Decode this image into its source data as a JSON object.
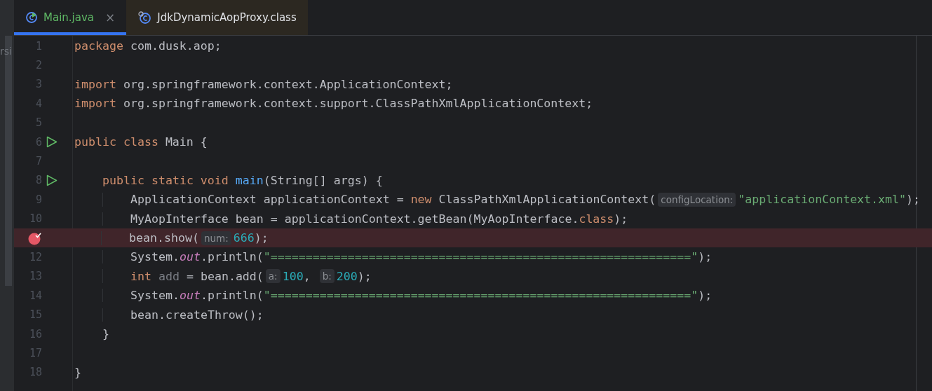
{
  "tabs": [
    {
      "label": "Main.java",
      "selected": true,
      "close": "×",
      "kind": "runnable",
      "color": "#5fb865"
    },
    {
      "label": "JdkDynamicAopProxy.class",
      "selected": false,
      "kind": "library",
      "color": "#dfe1e5"
    }
  ],
  "side_panel": {
    "label": "rsi"
  },
  "lines": [
    {
      "number": "1",
      "kind": "plain",
      "highlighted": false,
      "tokens": [
        {
          "kind": "keyword",
          "text": "package"
        },
        {
          "kind": "plain",
          "text": " com.dusk.aop;"
        }
      ]
    },
    {
      "number": "2",
      "kind": "plain",
      "highlighted": false
    },
    {
      "number": "3",
      "kind": "plain",
      "highlighted": false,
      "tokens": [
        {
          "kind": "keyword",
          "text": "import"
        },
        {
          "kind": "plain",
          "text": " org.springframework.context.ApplicationContext;"
        }
      ]
    },
    {
      "number": "4",
      "kind": "plain",
      "highlighted": false,
      "tokens": [
        {
          "kind": "keyword",
          "text": "import"
        },
        {
          "kind": "plain",
          "text": " org.springframework.context.support.ClassPathXmlApplicationContext;"
        }
      ]
    },
    {
      "number": "5",
      "kind": "plain",
      "highlighted": false
    },
    {
      "number": "6",
      "kind": "run",
      "highlighted": false,
      "tokens": [
        {
          "kind": "keyword",
          "text": "public class"
        },
        {
          "kind": "plain",
          "text": " Main {"
        }
      ],
      "children": [
        {
          "number": "7",
          "kind": "plain",
          "highlighted": false
        },
        {
          "number": "8",
          "kind": "run",
          "highlighted": false,
          "tokens": [
            {
              "kind": "keyword",
              "text": "public static void "
            },
            {
              "kind": "method",
              "text": "main"
            },
            {
              "kind": "plain",
              "text": "(String[] args) {"
            }
          ],
          "children": [
            {
              "number": "9",
              "kind": "plain",
              "highlighted": false,
              "tokens": [
                {
                  "kind": "plain",
                  "text": "ApplicationContext applicationContext = "
                },
                {
                  "kind": "keyword",
                  "text": "new"
                },
                {
                  "kind": "plain",
                  "text": " ClassPathXmlApplicationContext("
                },
                {
                  "kind": "hint",
                  "text": "configLocation:"
                },
                {
                  "kind": "string",
                  "text": "\"applicationContext.xml\""
                },
                {
                  "kind": "plain",
                  "text": ");"
                }
              ]
            },
            {
              "number": "10",
              "kind": "plain",
              "highlighted": false,
              "tokens": [
                {
                  "kind": "plain",
                  "text": "MyAopInterface bean = applicationContext.getBean(MyAopInterface."
                },
                {
                  "kind": "keyword",
                  "text": "class"
                },
                {
                  "kind": "plain",
                  "text": ");"
                }
              ]
            },
            {
              "kind": "breakpoint",
              "highlighted": true,
              "tokens": [
                {
                  "kind": "plain",
                  "text": "bean.show("
                },
                {
                  "kind": "hint",
                  "text": "num:"
                },
                {
                  "kind": "number",
                  "text": "666"
                },
                {
                  "kind": "plain",
                  "text": ");"
                }
              ]
            },
            {
              "number": "12",
              "kind": "plain",
              "highlighted": false,
              "tokens": [
                {
                  "kind": "plain",
                  "text": "System."
                },
                {
                  "kind": "field",
                  "text": "out"
                },
                {
                  "kind": "plain",
                  "text": ".println("
                },
                {
                  "kind": "string",
                  "text": "\"============================================================\""
                },
                {
                  "kind": "plain",
                  "text": ");"
                }
              ]
            },
            {
              "number": "13",
              "kind": "plain",
              "highlighted": false,
              "tokens": [
                {
                  "kind": "keyword",
                  "text": "int "
                },
                {
                  "kind": "unused",
                  "text": "add"
                },
                {
                  "kind": "plain",
                  "text": " = bean.add("
                },
                {
                  "kind": "hint",
                  "text": "a:"
                },
                {
                  "kind": "number",
                  "text": "100"
                },
                {
                  "kind": "plain",
                  "text": ", "
                },
                {
                  "kind": "hint",
                  "text": "b:"
                },
                {
                  "kind": "number",
                  "text": "200"
                },
                {
                  "kind": "plain",
                  "text": ");"
                }
              ]
            },
            {
              "number": "14",
              "kind": "plain",
              "highlighted": false,
              "tokens": [
                {
                  "kind": "plain",
                  "text": "System."
                },
                {
                  "kind": "field",
                  "text": "out"
                },
                {
                  "kind": "plain",
                  "text": ".println("
                },
                {
                  "kind": "string",
                  "text": "\"============================================================\""
                },
                {
                  "kind": "plain",
                  "text": ");"
                }
              ]
            },
            {
              "number": "15",
              "kind": "plain",
              "highlighted": false,
              "tokens": [
                {
                  "kind": "plain",
                  "text": "bean.createThrow();"
                }
              ]
            }
          ]
        },
        {
          "number": "16",
          "kind": "plain",
          "highlighted": false,
          "tokens": [
            {
              "kind": "plain",
              "text": "}"
            }
          ]
        },
        {
          "number": "17",
          "kind": "plain",
          "highlighted": false
        }
      ]
    },
    {
      "number": "18",
      "kind": "plain",
      "highlighted": false,
      "tokens": [
        {
          "kind": "plain",
          "text": "}"
        }
      ]
    }
  ]
}
